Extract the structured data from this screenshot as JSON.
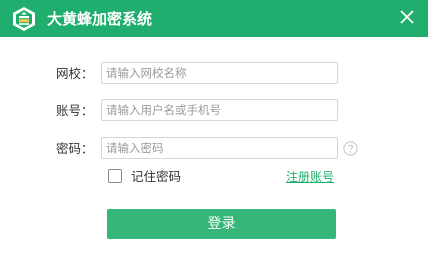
{
  "window": {
    "title": "大黄蜂加密系统",
    "logo_icon": "hexagon-shield-logo-icon",
    "close_icon": "close-icon",
    "accent_color": "#1fae6e"
  },
  "form": {
    "school": {
      "label": "网校：",
      "placeholder": "请输入网校名称",
      "value": ""
    },
    "account": {
      "label": "账号：",
      "placeholder": "请输入用户名或手机号",
      "value": ""
    },
    "password": {
      "label": "密码：",
      "placeholder": "请输入密码",
      "value": ""
    },
    "help_icon": "question-mark-circle-icon",
    "remember": {
      "label": "记住密码",
      "checked": false
    },
    "register_link": "注册账号",
    "login_button": "登录",
    "login_button_color": "#35b779"
  }
}
